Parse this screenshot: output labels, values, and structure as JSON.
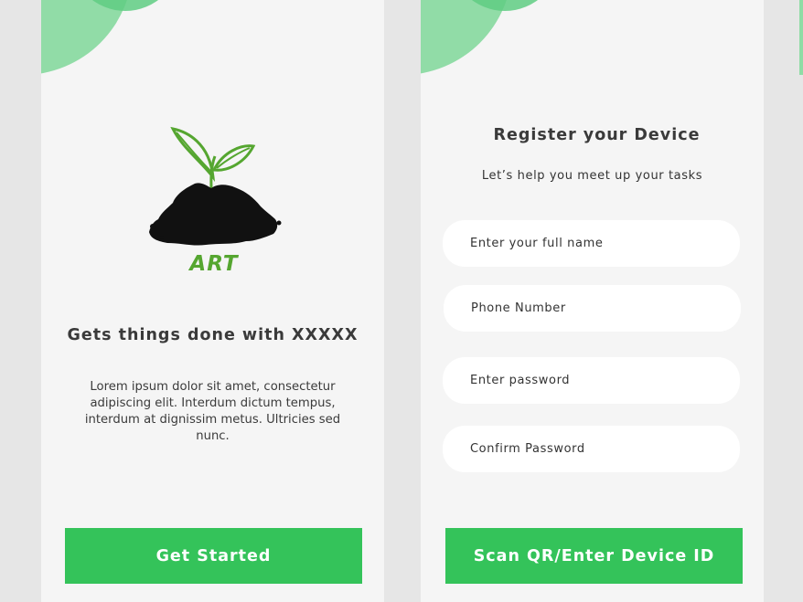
{
  "colors": {
    "background": "#e6e6e6",
    "screen": "#f5f5f5",
    "accent_green": "#34c35a",
    "circle_light": "#91dca7",
    "circle_dark": "#5fcc83",
    "logo_green": "#55a630"
  },
  "welcome": {
    "logo_icon": "sprout-in-soil-icon",
    "logo_text": "ART",
    "headline": "Gets things done with XXXXX",
    "paragraph": "Lorem ipsum dolor sit amet, consectetur adipiscing elit. Interdum dictum tempus, interdum at dignissim metus. Ultricies sed nunc.",
    "button_label": "Get Started"
  },
  "register": {
    "title": "Register your Device",
    "subtitle": "Let’s help you meet up your tasks",
    "fields": {
      "full_name": {
        "value": "",
        "placeholder": "Enter your full name"
      },
      "phone": {
        "value": "",
        "placeholder": "Phone Number"
      },
      "password": {
        "value": "",
        "placeholder": "Enter password"
      },
      "confirm_password": {
        "value": "",
        "placeholder": "Confirm Password"
      }
    },
    "button_label": "Scan QR/Enter Device ID"
  }
}
